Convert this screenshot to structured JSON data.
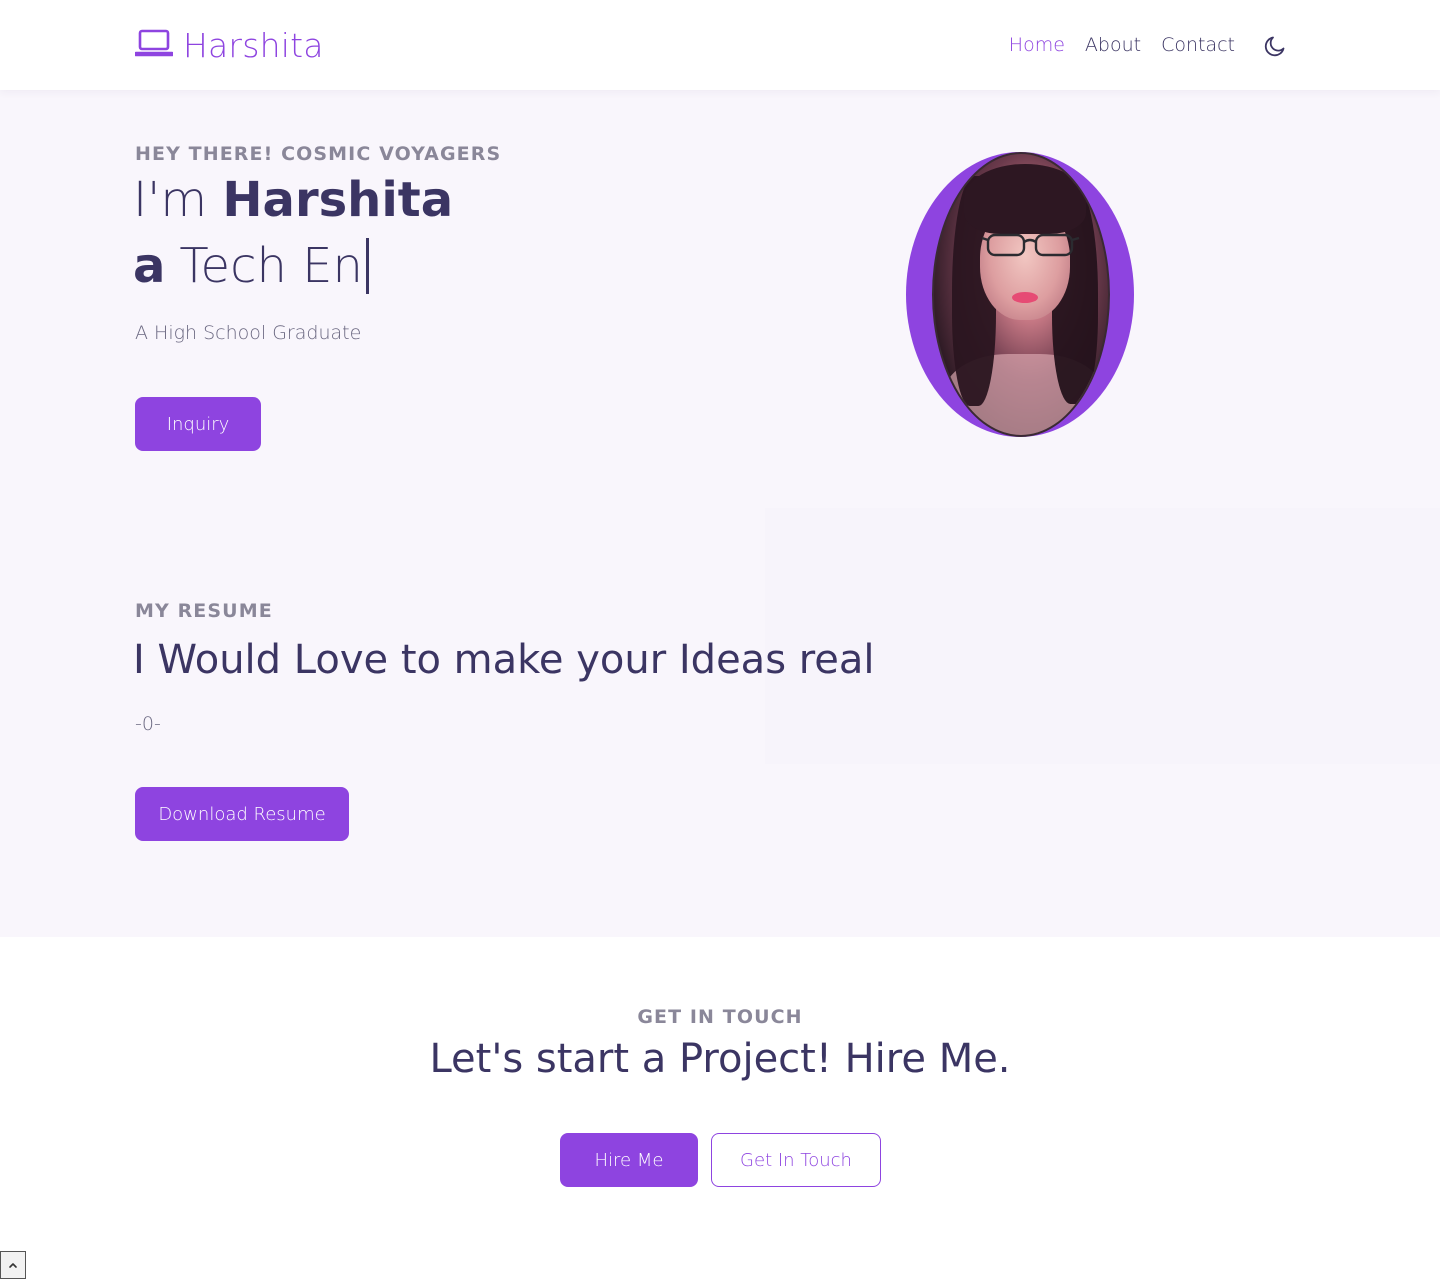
{
  "brand": {
    "name": "Harshita",
    "icon": "laptop-icon",
    "color": "#8e44e0"
  },
  "nav": {
    "items": [
      {
        "label": "Home",
        "active": true
      },
      {
        "label": "About",
        "active": false
      },
      {
        "label": "Contact",
        "active": false
      }
    ],
    "theme_toggle_icon": "moon-icon"
  },
  "hero": {
    "eyebrow": "Hey There! Cosmic Voyagers",
    "greeting": "I'm",
    "name": "Harshita",
    "article": "a",
    "typed_text": "Tech En",
    "subtitle": "A High School Graduate",
    "button_label": "Inquiry",
    "portrait_alt": "Portrait of Harshita"
  },
  "resume": {
    "eyebrow": "My Resume",
    "title": "I Would Love to make your Ideas real",
    "subtitle": "-0-",
    "button_label": "Download Resume"
  },
  "contact": {
    "eyebrow": "Get In Touch",
    "title": "Let's start a Project! Hire Me.",
    "primary_button": "Hire Me",
    "secondary_button": "Get In Touch"
  },
  "back_to_top_icon": "chevron-up-icon",
  "colors": {
    "accent": "#8e44e0",
    "text": "#3b3563",
    "muted": "#8a8799",
    "hero_bg": "#f9f6fc"
  }
}
